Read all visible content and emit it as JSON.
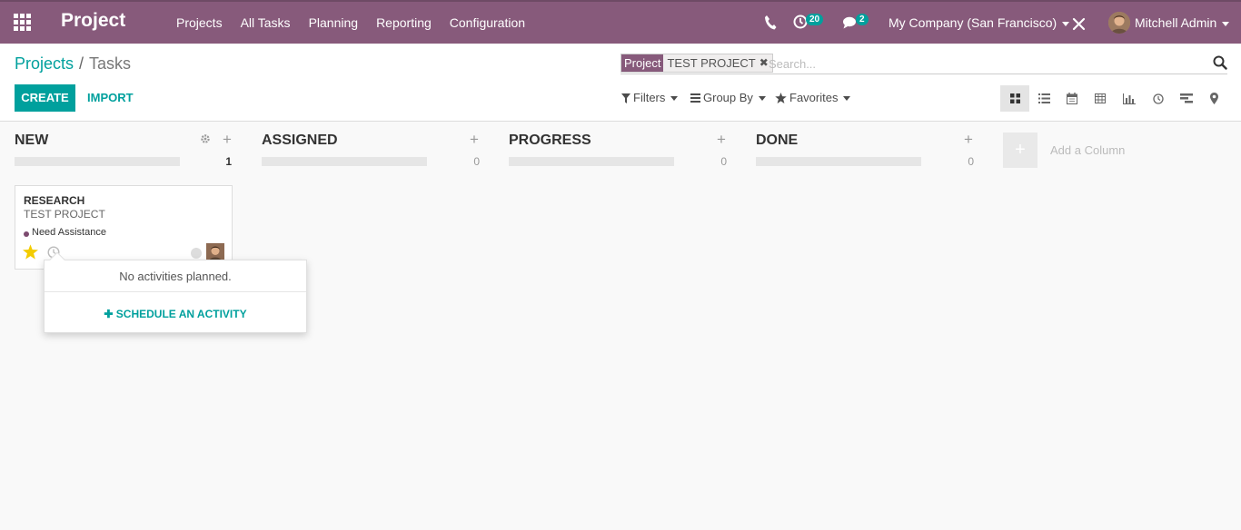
{
  "navbar": {
    "app_name": "Project",
    "menu": [
      "Projects",
      "All Tasks",
      "Planning",
      "Reporting",
      "Configuration"
    ],
    "activity_count": "20",
    "message_count": "2",
    "company": "My Company (San Francisco)",
    "user": "Mitchell Admin",
    "brand_color": "#875a7b"
  },
  "breadcrumb": {
    "parent": "Projects",
    "separator": "/",
    "current": "Tasks"
  },
  "search": {
    "facet_label": "Project",
    "facet_value": "TEST PROJECT",
    "placeholder": "Search..."
  },
  "buttons": {
    "create": "CREATE",
    "import": "IMPORT"
  },
  "search_options": {
    "filters": "Filters",
    "group_by": "Group By",
    "favorites": "Favorites"
  },
  "views": [
    "kanban-icon",
    "list-icon",
    "calendar-icon",
    "pivot-icon",
    "graph-icon",
    "activity-icon",
    "gantt-icon",
    "map-icon"
  ],
  "columns": [
    {
      "title": "NEW",
      "count": "1"
    },
    {
      "title": "ASSIGNED",
      "count": "0"
    },
    {
      "title": "PROGRESS",
      "count": "0"
    },
    {
      "title": "DONE",
      "count": "0"
    }
  ],
  "add_column": {
    "label": "Add a Column"
  },
  "card": {
    "title": "RESEARCH",
    "project": "TEST PROJECT",
    "tag": "Need Assistance",
    "starred": true
  },
  "activity_popover": {
    "message": "No activities planned.",
    "action": "SCHEDULE AN ACTIVITY"
  },
  "accent_color": "#00a09d"
}
